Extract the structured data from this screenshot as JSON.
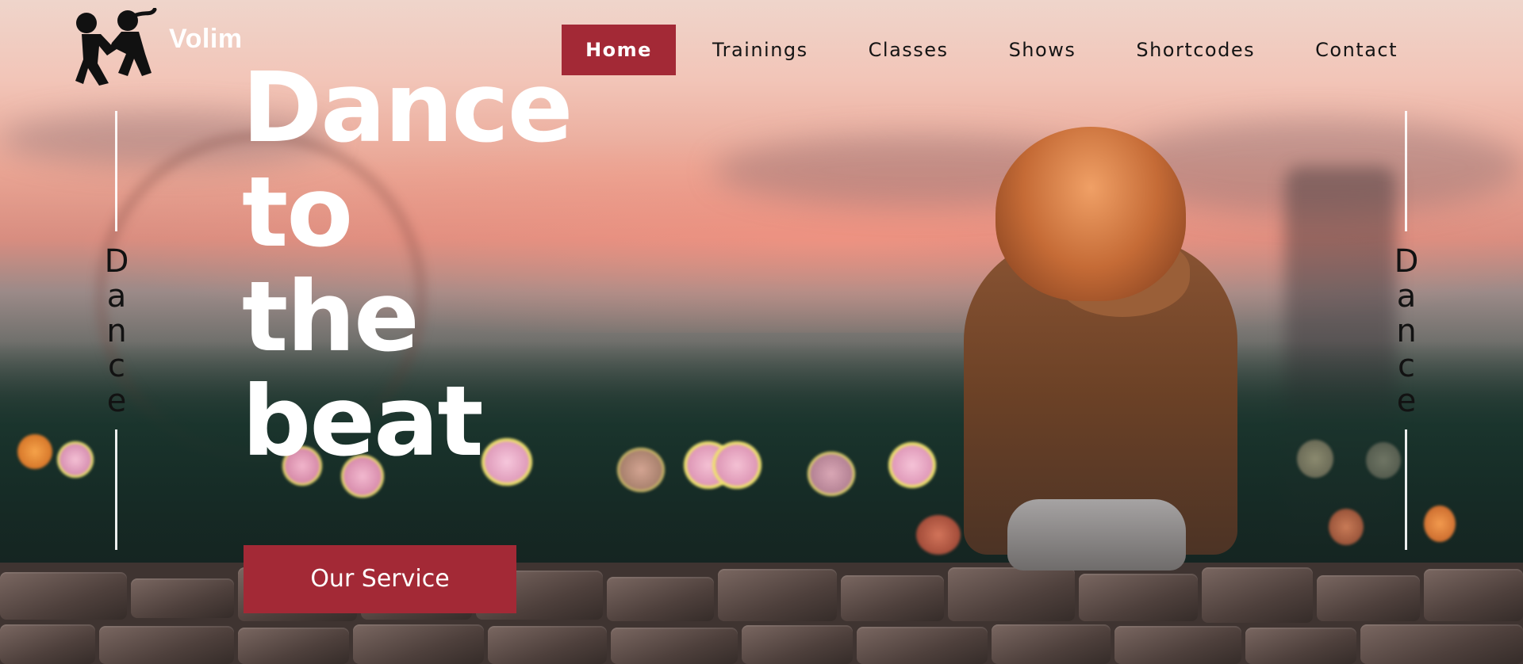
{
  "brand": {
    "name": "Volim",
    "logo_icon": "dancing-couple-icon"
  },
  "nav": {
    "items": [
      {
        "label": "Home",
        "active": true
      },
      {
        "label": "Trainings",
        "active": false
      },
      {
        "label": "Classes",
        "active": false
      },
      {
        "label": "Shows",
        "active": false
      },
      {
        "label": "Shortcodes",
        "active": false
      },
      {
        "label": "Contact",
        "active": false
      }
    ]
  },
  "hero": {
    "headline_lines": [
      "Dance",
      "to",
      "the",
      "beat"
    ],
    "cta_label": "Our Service",
    "side_word_letters": [
      "D",
      "a",
      "n",
      "c",
      "e"
    ]
  },
  "colors": {
    "accent": "#a32936",
    "nav_text": "#141414",
    "headline": "#ffffff"
  }
}
